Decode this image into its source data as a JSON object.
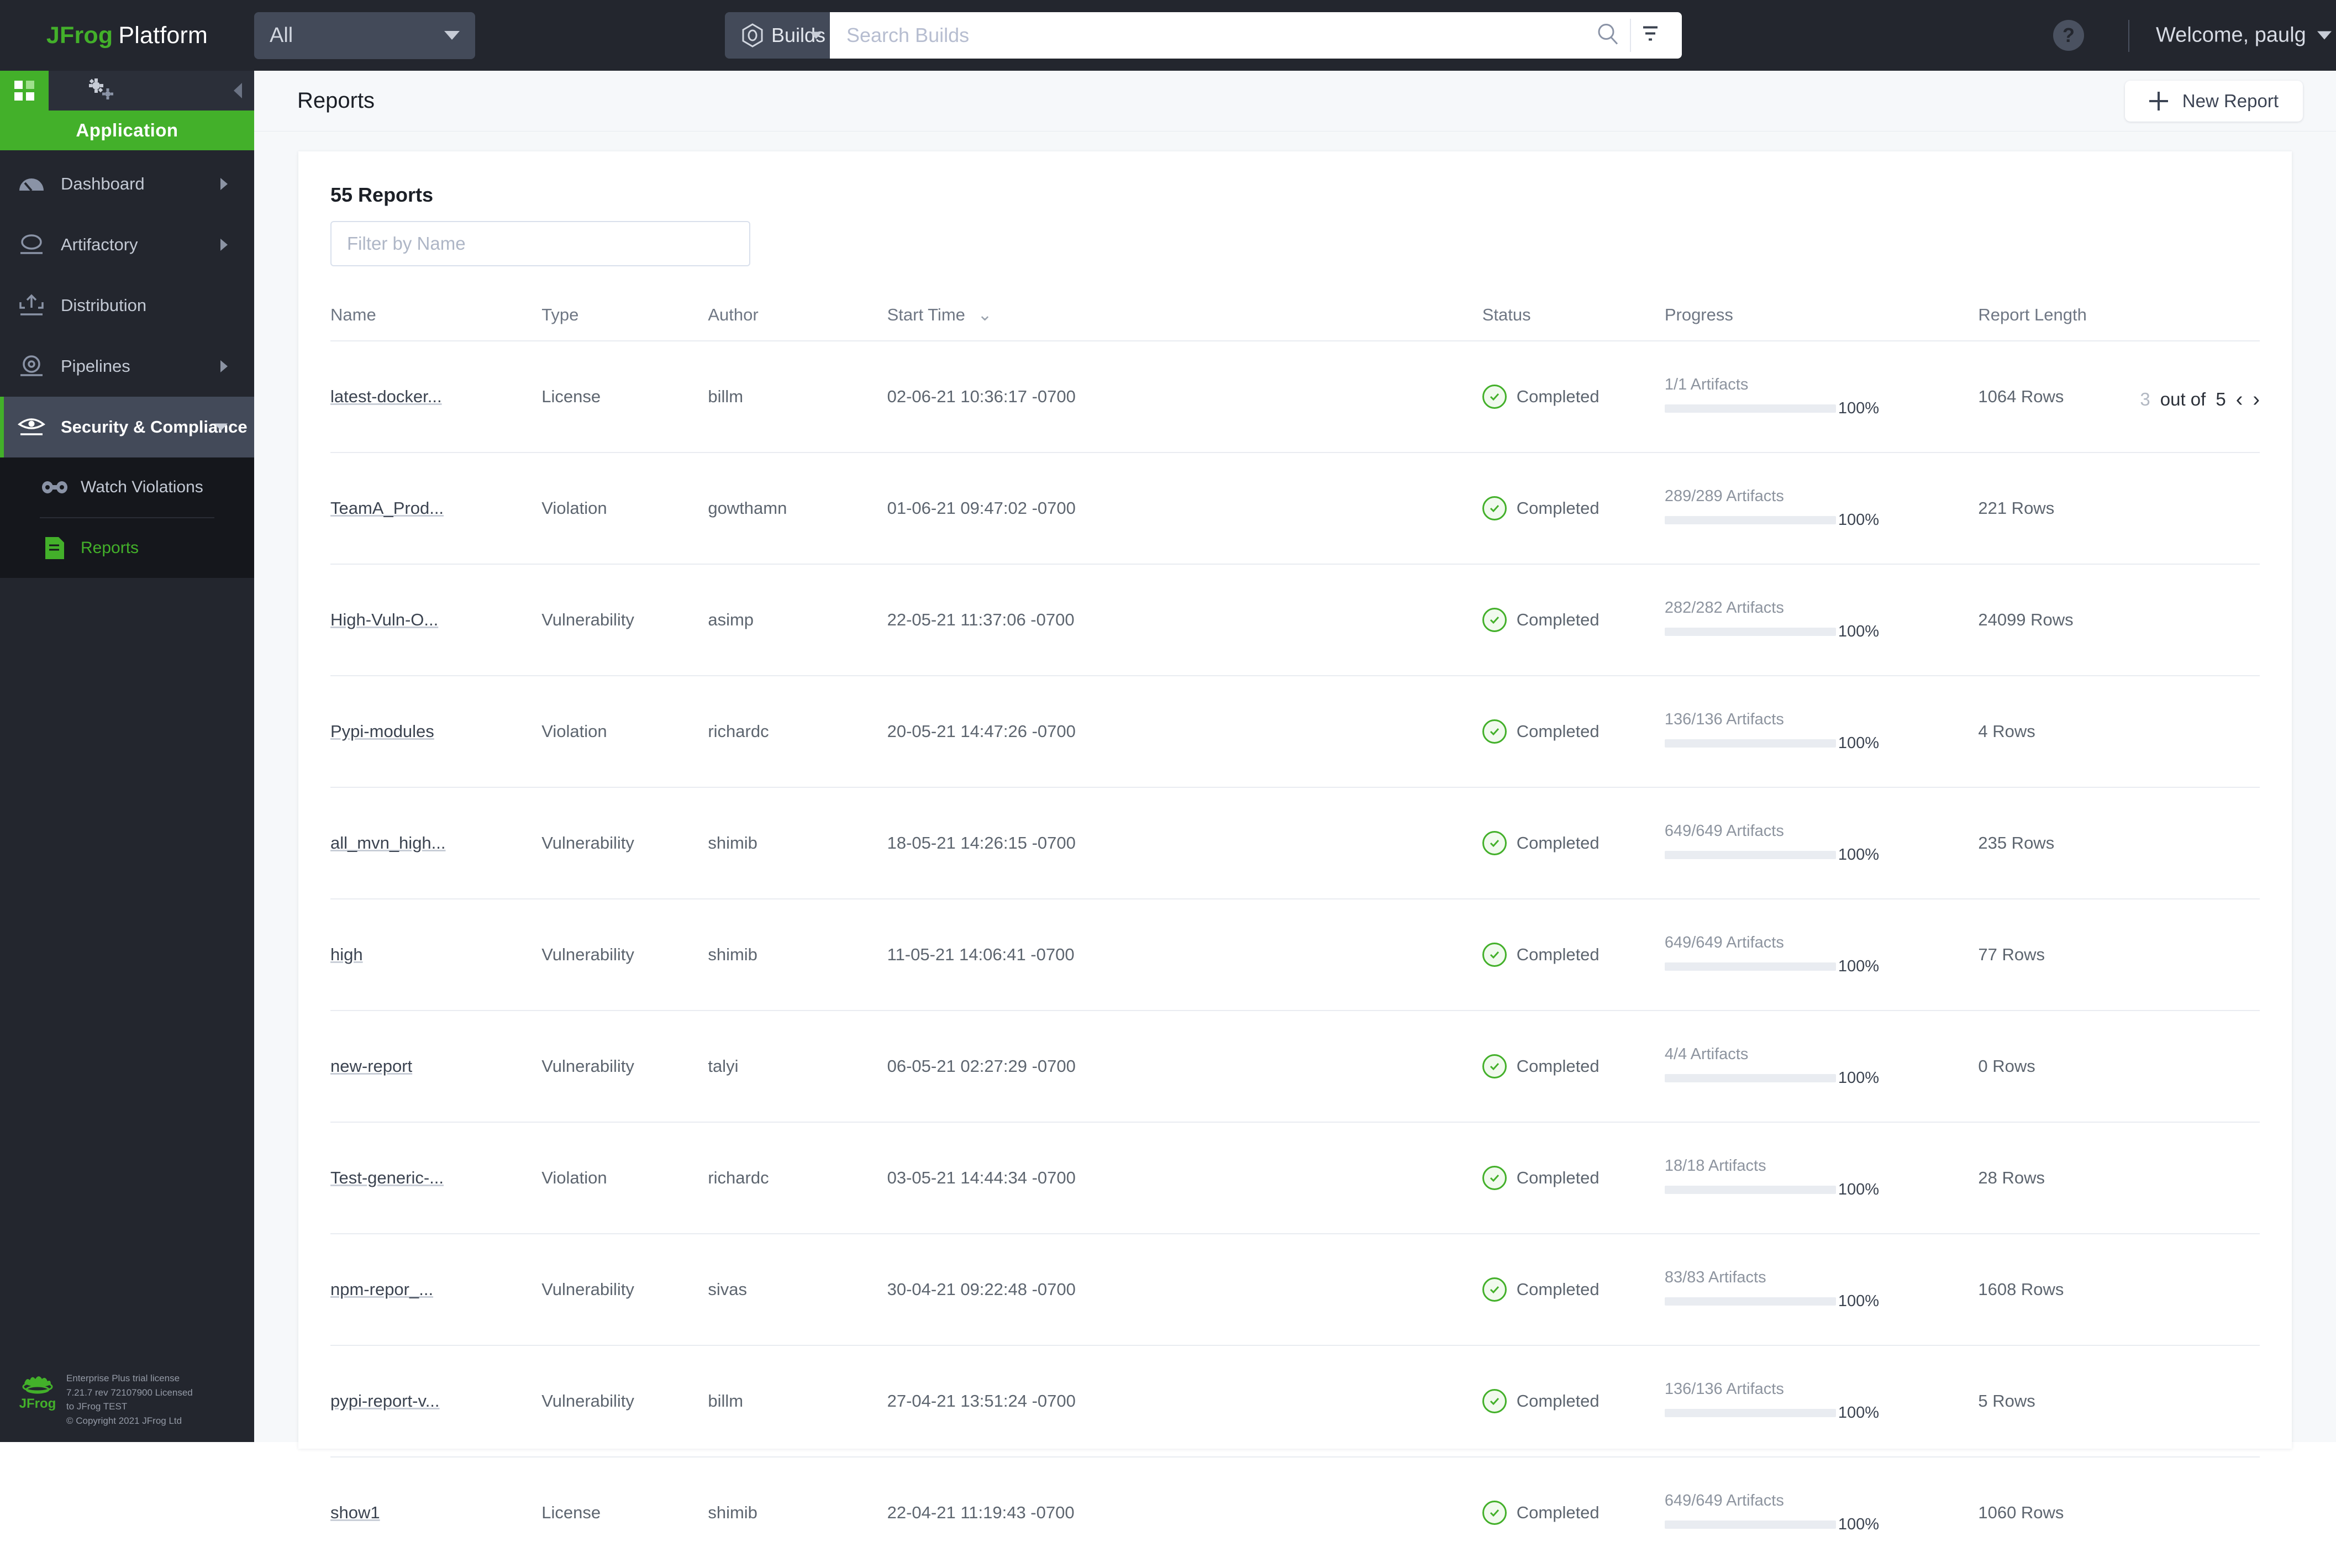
{
  "header": {
    "brand_jfrog": "JFrog",
    "brand_platform": "Platform",
    "scope_value": "All",
    "builds_label": "Builds",
    "search_placeholder": "Search Builds",
    "search_value": "",
    "help_label": "?",
    "welcome_label": "Welcome, paulg"
  },
  "sidebar": {
    "app_banner": "Application",
    "items": [
      {
        "label": "Dashboard",
        "icon": "gauge-icon",
        "has_arrow": true,
        "active": false
      },
      {
        "label": "Artifactory",
        "icon": "artifactory-icon",
        "has_arrow": true,
        "active": false
      },
      {
        "label": "Distribution",
        "icon": "distribution-icon",
        "has_arrow": false,
        "active": false
      },
      {
        "label": "Pipelines",
        "icon": "pipelines-icon",
        "has_arrow": true,
        "active": false
      },
      {
        "label": "Security & Compliance",
        "icon": "eye-icon",
        "has_arrow": true,
        "active": true
      }
    ],
    "subitems": [
      {
        "label": "Watch Violations",
        "icon": "binoculars-icon",
        "active": false
      },
      {
        "label": "Reports",
        "icon": "report-doc-icon",
        "active": true
      }
    ],
    "license": {
      "line1": "Enterprise Plus trial license",
      "line2": "7.21.7 rev 72107900 Licensed",
      "line3": "to JFrog TEST",
      "line4": "© Copyright 2021 JFrog Ltd"
    }
  },
  "page": {
    "title": "Reports",
    "new_report_label": "New Report"
  },
  "reports_panel": {
    "count_title": "55 Reports",
    "filter_placeholder": "Filter by Name",
    "filter_value": "",
    "pagination": {
      "current": "3",
      "of_label": "out of",
      "total": "5",
      "prev_icon": "‹",
      "next_icon": "›"
    },
    "columns": [
      "Name",
      "Type",
      "Author",
      "Start Time",
      "Status",
      "Progress",
      "Report Length"
    ],
    "sorted_column": "Start Time",
    "rows": [
      {
        "name": "latest-docker...",
        "type": "License",
        "author": "billm",
        "start_time": "02-06-21 10:36:17 -0700",
        "status": "Completed",
        "artifacts": "1/1 Artifacts",
        "percent": "100%",
        "percent_value": 100,
        "length": "1064 Rows"
      },
      {
        "name": "TeamA_Prod...",
        "type": "Violation",
        "author": "gowthamn",
        "start_time": "01-06-21 09:47:02 -0700",
        "status": "Completed",
        "artifacts": "289/289 Artifacts",
        "percent": "100%",
        "percent_value": 100,
        "length": "221 Rows"
      },
      {
        "name": "High-Vuln-O...",
        "type": "Vulnerability",
        "author": "asimp",
        "start_time": "22-05-21 11:37:06 -0700",
        "status": "Completed",
        "artifacts": "282/282 Artifacts",
        "percent": "100%",
        "percent_value": 100,
        "length": "24099 Rows"
      },
      {
        "name": "Pypi-modules",
        "type": "Violation",
        "author": "richardc",
        "start_time": "20-05-21 14:47:26 -0700",
        "status": "Completed",
        "artifacts": "136/136 Artifacts",
        "percent": "100%",
        "percent_value": 100,
        "length": "4 Rows"
      },
      {
        "name": "all_mvn_high...",
        "type": "Vulnerability",
        "author": "shimib",
        "start_time": "18-05-21 14:26:15 -0700",
        "status": "Completed",
        "artifacts": "649/649 Artifacts",
        "percent": "100%",
        "percent_value": 100,
        "length": "235 Rows"
      },
      {
        "name": "high",
        "type": "Vulnerability",
        "author": "shimib",
        "start_time": "11-05-21 14:06:41 -0700",
        "status": "Completed",
        "artifacts": "649/649 Artifacts",
        "percent": "100%",
        "percent_value": 100,
        "length": "77 Rows"
      },
      {
        "name": "new-report",
        "type": "Vulnerability",
        "author": "talyi",
        "start_time": "06-05-21 02:27:29 -0700",
        "status": "Completed",
        "artifacts": "4/4 Artifacts",
        "percent": "100%",
        "percent_value": 100,
        "length": "0 Rows"
      },
      {
        "name": "Test-generic-...",
        "type": "Violation",
        "author": "richardc",
        "start_time": "03-05-21 14:44:34 -0700",
        "status": "Completed",
        "artifacts": "18/18 Artifacts",
        "percent": "100%",
        "percent_value": 100,
        "length": "28 Rows"
      },
      {
        "name": "npm-repor_...",
        "type": "Vulnerability",
        "author": "sivas",
        "start_time": "30-04-21 09:22:48 -0700",
        "status": "Completed",
        "artifacts": "83/83 Artifacts",
        "percent": "100%",
        "percent_value": 100,
        "length": "1608 Rows"
      },
      {
        "name": "pypi-report-v...",
        "type": "Vulnerability",
        "author": "billm",
        "start_time": "27-04-21 13:51:24 -0700",
        "status": "Completed",
        "artifacts": "136/136 Artifacts",
        "percent": "100%",
        "percent_value": 100,
        "length": "5 Rows"
      },
      {
        "name": "show1",
        "type": "License",
        "author": "shimib",
        "start_time": "22-04-21 11:19:43 -0700",
        "status": "Completed",
        "artifacts": "649/649 Artifacts",
        "percent": "100%",
        "percent_value": 100,
        "length": "1060 Rows"
      }
    ]
  },
  "colors": {
    "brand_green": "#43b02a",
    "header_bg": "#23262e",
    "sidebar_sub_bg": "#15171c",
    "page_bg": "#f6f8fa"
  }
}
